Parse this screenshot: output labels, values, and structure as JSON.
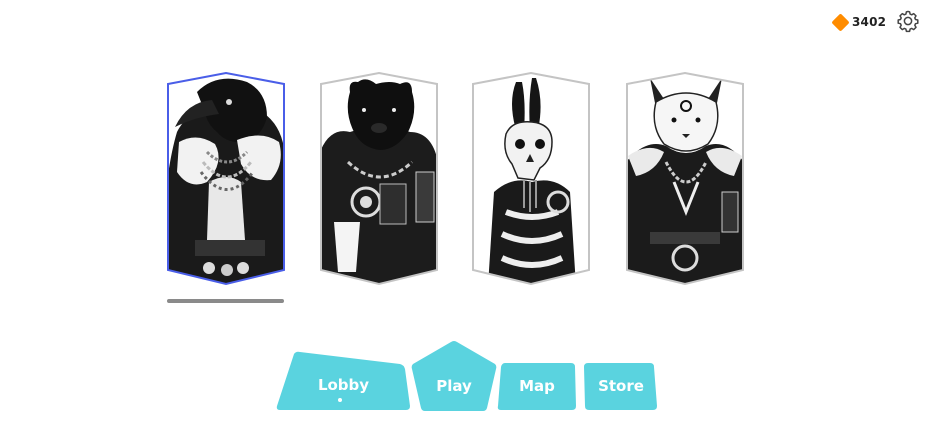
{
  "currency": {
    "amount": "3402",
    "icon": "gem-icon",
    "color": "#ff8c00"
  },
  "settings": {
    "icon": "gear-icon"
  },
  "characters": [
    {
      "name": "raven",
      "selected": true
    },
    {
      "name": "bear",
      "selected": false
    },
    {
      "name": "rabbit",
      "selected": false
    },
    {
      "name": "fox",
      "selected": false
    }
  ],
  "nav": {
    "lobby": "Lobby",
    "play": "Play",
    "map": "Map",
    "store": "Store",
    "active": "lobby"
  },
  "colors": {
    "accent": "#5ad3df",
    "selected_border": "#4a5ee8",
    "card_border": "#c4c4c4"
  }
}
